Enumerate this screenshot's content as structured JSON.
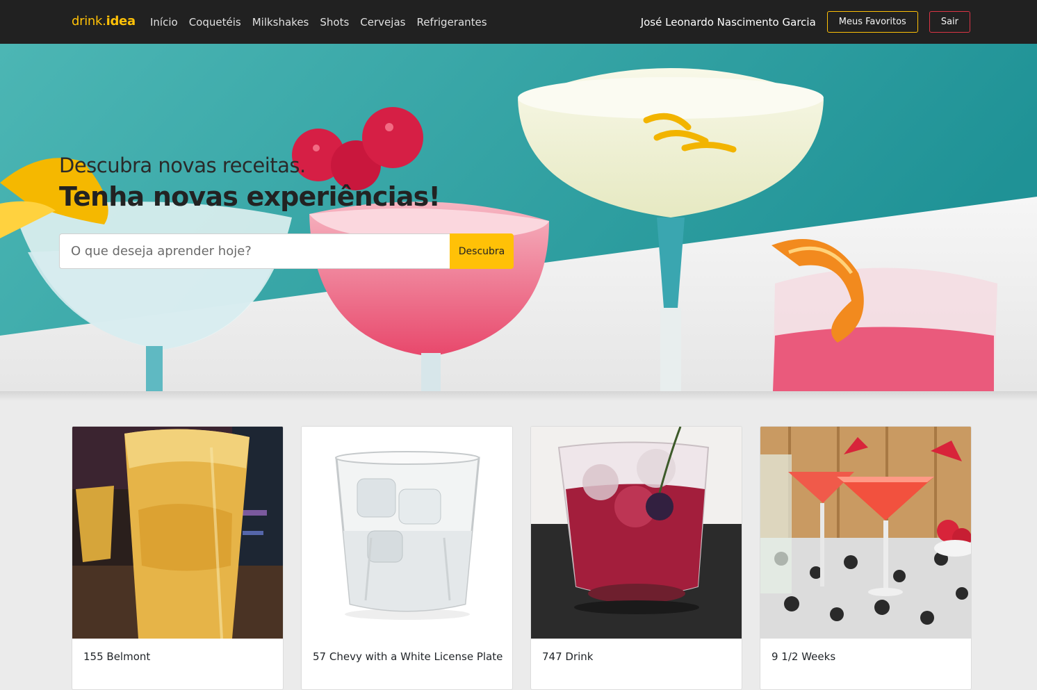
{
  "brand": {
    "name_light": "drink.",
    "name_bold": "idea",
    "color": "#ffc107"
  },
  "nav": {
    "links": [
      "Início",
      "Coquetéis",
      "Milkshakes",
      "Shots",
      "Cervejas",
      "Refrigerantes"
    ],
    "user": "José Leonardo Nascimento Garcia",
    "favorites_label": "Meus Favoritos",
    "logout_label": "Sair"
  },
  "hero": {
    "subtitle": "Descubra novas receitas.",
    "title": "Tenha novas experiências!",
    "search_placeholder": "O que deseja aprender hoje?",
    "search_button": "Descubra"
  },
  "cards": [
    {
      "title": "155 Belmont"
    },
    {
      "title": "57 Chevy with a White License Plate"
    },
    {
      "title": "747 Drink"
    },
    {
      "title": "9 1/2 Weeks"
    }
  ],
  "colors": {
    "accent": "#ffc107",
    "danger": "#dc3545",
    "navbar": "#212121",
    "hero_teal": "#2aa2a2"
  }
}
